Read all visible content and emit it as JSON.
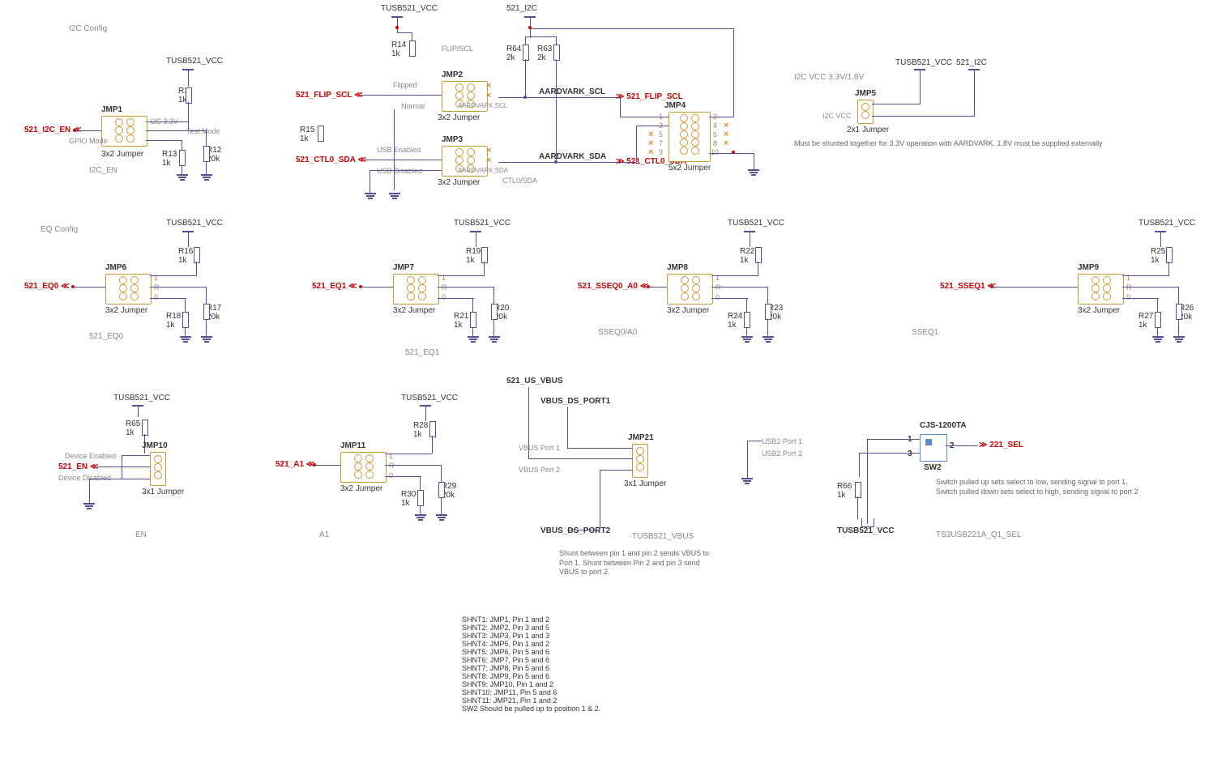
{
  "power_rails": {
    "vcc": "TUSB521_VCC",
    "i2c": "521_I2C"
  },
  "sections": {
    "i2c_config": "I2C Config",
    "eq_config": "EQ Config"
  },
  "jmp1": {
    "name": "JMP1",
    "type": "3x2 Jumper",
    "signal": "521_I2C_EN",
    "p1": "I2C 3.3V",
    "p2": "Test Mode",
    "p3": "GPIO Mode",
    "sub": "I2C_EN",
    "r11": "R11",
    "r11v": "1k",
    "r12": "R12",
    "r12v": "20k",
    "r13": "R13",
    "r13v": "1k"
  },
  "jmp2": {
    "name": "JMP2",
    "type": "3x2 Jumper",
    "signal": "521_FLIP_SCL",
    "p1": "Flipped",
    "p2": "Normal",
    "p3": "AARDVARK SCL",
    "label_top": "FLIP/SCL",
    "r14": "R14",
    "r14v": "1k",
    "r15": "R15",
    "r15v": "1k"
  },
  "jmp3": {
    "name": "JMP3",
    "type": "3x2 Jumper",
    "signal": "521_CTL0_SDA",
    "p1": "USB Enabled",
    "p2": "USB Disabled",
    "p3": "AARDVARK SDA",
    "label_r": "CTL0/SDA"
  },
  "jmp4": {
    "name": "JMP4",
    "type": "5x2 Jumper",
    "aardvark_scl": "AARDVARK_SCL",
    "aardvark_sda": "AARDVARK_SDA",
    "out_scl": "521_FLIP_SCL",
    "out_sda": "521_CTL0_SDA",
    "r63": "R63",
    "r63v": "2k",
    "r64": "R64",
    "r64v": "2k",
    "pins": [
      "1",
      "2",
      "3",
      "4",
      "5",
      "6",
      "7",
      "8",
      "9",
      "10"
    ]
  },
  "jmp5": {
    "name": "JMP5",
    "type": "2x1 Jumper",
    "note_top": "I2C VCC 3.3V/1.8V",
    "label": "I2C VCC",
    "note": "Must be shunted together for 3.3V operation with AARDVARK. 1.8V must be supplied externally"
  },
  "jmp6": {
    "name": "JMP6",
    "type": "3x2 Jumper",
    "signal": "521_EQ0",
    "sub": "521_EQ0",
    "p1": "1",
    "p2": "R",
    "p3": "0",
    "r16": "R16",
    "r16v": "1k",
    "r17": "R17",
    "r17v": "20k",
    "r18": "R18",
    "r18v": "1k"
  },
  "jmp7": {
    "name": "JMP7",
    "type": "3x2 Jumper",
    "signal": "521_EQ1",
    "sub": "521_EQ1",
    "p1": "1",
    "p2": "R",
    "p3": "0",
    "r19": "R19",
    "r19v": "1k",
    "r20": "R20",
    "r20v": "20k",
    "r21": "R21",
    "r21v": "1k"
  },
  "jmp8": {
    "name": "JMP8",
    "type": "3x2 Jumper",
    "signal": "521_SSEQ0_A0",
    "sub": "SSEQ0/A0",
    "p1": "1",
    "p2": "R",
    "p3": "0",
    "r22": "R22",
    "r22v": "1k",
    "r23": "R23",
    "r23v": "20k",
    "r24": "R24",
    "r24v": "1k"
  },
  "jmp9": {
    "name": "JMP9",
    "type": "3x2 Jumper",
    "signal": "521_SSEQ1",
    "sub": "SSEQ1",
    "p1": "1",
    "p2": "R",
    "p3": "0",
    "r25": "R25",
    "r25v": "1k",
    "r26": "R26",
    "r26v": "20k",
    "r27": "R27",
    "r27v": "1k"
  },
  "jmp10": {
    "name": "JMP10",
    "type": "3x1 Jumper",
    "signal": "521_EN",
    "p1": "Device Enabled",
    "p2": "Device Disabled",
    "sub": "EN",
    "r65": "R65",
    "r65v": "1k"
  },
  "jmp11": {
    "name": "JMP11",
    "type": "3x2 Jumper",
    "signal": "521_A1",
    "sub": "A1",
    "p1": "1",
    "p2": "R",
    "p3": "0",
    "r28": "R28",
    "r28v": "1k",
    "r29": "R29",
    "r29v": "20k",
    "r30": "R30",
    "r30v": "1k"
  },
  "jmp21": {
    "name": "JMP21",
    "type": "3x1 Jumper",
    "top": "521_US_VBUS",
    "p_ds1": "VBUS_DS_PORT1",
    "p_ds2": "VBUS_DS_PORT2",
    "t1": "VBUS Port 1",
    "t2": "VBUS Port 2",
    "sub": "TUSB521_VBUS",
    "note": "Shunt between pin 1 and pin 2 sends VBUS to Port 1. Shunt between Pin 2 and pin 3 send VBUS to port 2."
  },
  "sw2": {
    "name": "SW2",
    "part": "CJS-1200TA",
    "p1": "USB2 Port 1",
    "p2": "USB2 Port 2",
    "pin1": "1",
    "pin2": "2",
    "pin3": "3",
    "out": "221_SEL",
    "r66": "R66",
    "r66v": "1k",
    "note": "Switch pulled up sets select to low, sending signal to port 1. Switch pulled down sets select to high, sending signal to port 2",
    "sub": "TS3USB221A_Q1_SEL"
  },
  "shunt_notes": [
    "SHNT1: JMP1, Pin 1 and 2",
    "SHNT2: JMP2, Pin 3 and 5",
    "SHNT3: JMP3, Pin 1 and 3",
    "SHNT4: JMP5, Pin 1 and 2",
    "SHNT5: JMP6, Pin 5 and 6",
    "SHNT6: JMP7, Pin 5 and 6",
    "SHNT7: JMP8, Pin 5 and 6",
    "SHNT8: JMP9, Pin 5 and 6",
    "SHNT9: JMP10, Pin 1 and 2",
    "SHNT10: JMP11, Pin 5 and 6",
    "SHNT11: JMP21, Pin 1 and 2",
    "SW2 Should be pulled up to position 1 & 2."
  ]
}
